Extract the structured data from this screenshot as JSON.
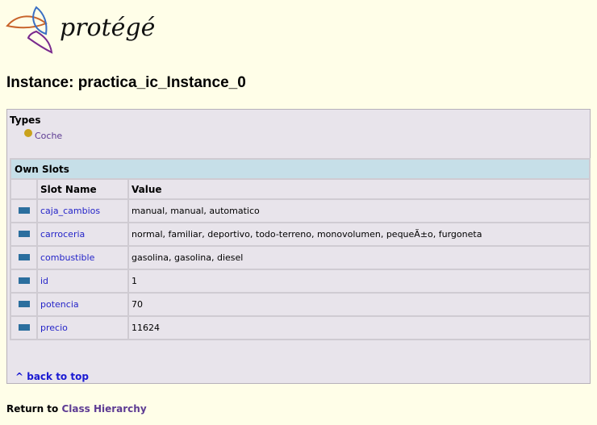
{
  "logo": {
    "text": "protégé",
    "colors": {
      "orange": "#c8632a",
      "blue": "#3a6fc4",
      "purple": "#7a2a8e"
    }
  },
  "page": {
    "title": "Instance: practica_ic_Instance_0"
  },
  "types": {
    "heading": "Types",
    "items": [
      {
        "label": "Coche",
        "icon": "class-dot-icon",
        "color": "#c9a21c"
      }
    ]
  },
  "own_slots": {
    "caption": "Own Slots",
    "columns": [
      "",
      "Slot Name",
      "Value"
    ],
    "rows": [
      {
        "name": "caja_cambios",
        "value": "manual, manual, automatico"
      },
      {
        "name": "carroceria",
        "value": "normal, familiar, deportivo, todo-terreno, monovolumen, pequeÃ±o, furgoneta"
      },
      {
        "name": "combustible",
        "value": "gasolina, gasolina, diesel"
      },
      {
        "name": "id",
        "value": "1"
      },
      {
        "name": "potencia",
        "value": "70"
      },
      {
        "name": "precio",
        "value": "11624"
      }
    ]
  },
  "back_to_top": "^ back to top",
  "footer": {
    "prefix": "Return to ",
    "link": "Class Hierarchy"
  },
  "colors": {
    "page_bg": "#fffee8",
    "box_bg": "#e8e4eb",
    "header_bg": "#c6dfe8",
    "slot_link": "#2424c8",
    "visited_link": "#5d3b93",
    "slot_icon": "#2b6e9e"
  }
}
